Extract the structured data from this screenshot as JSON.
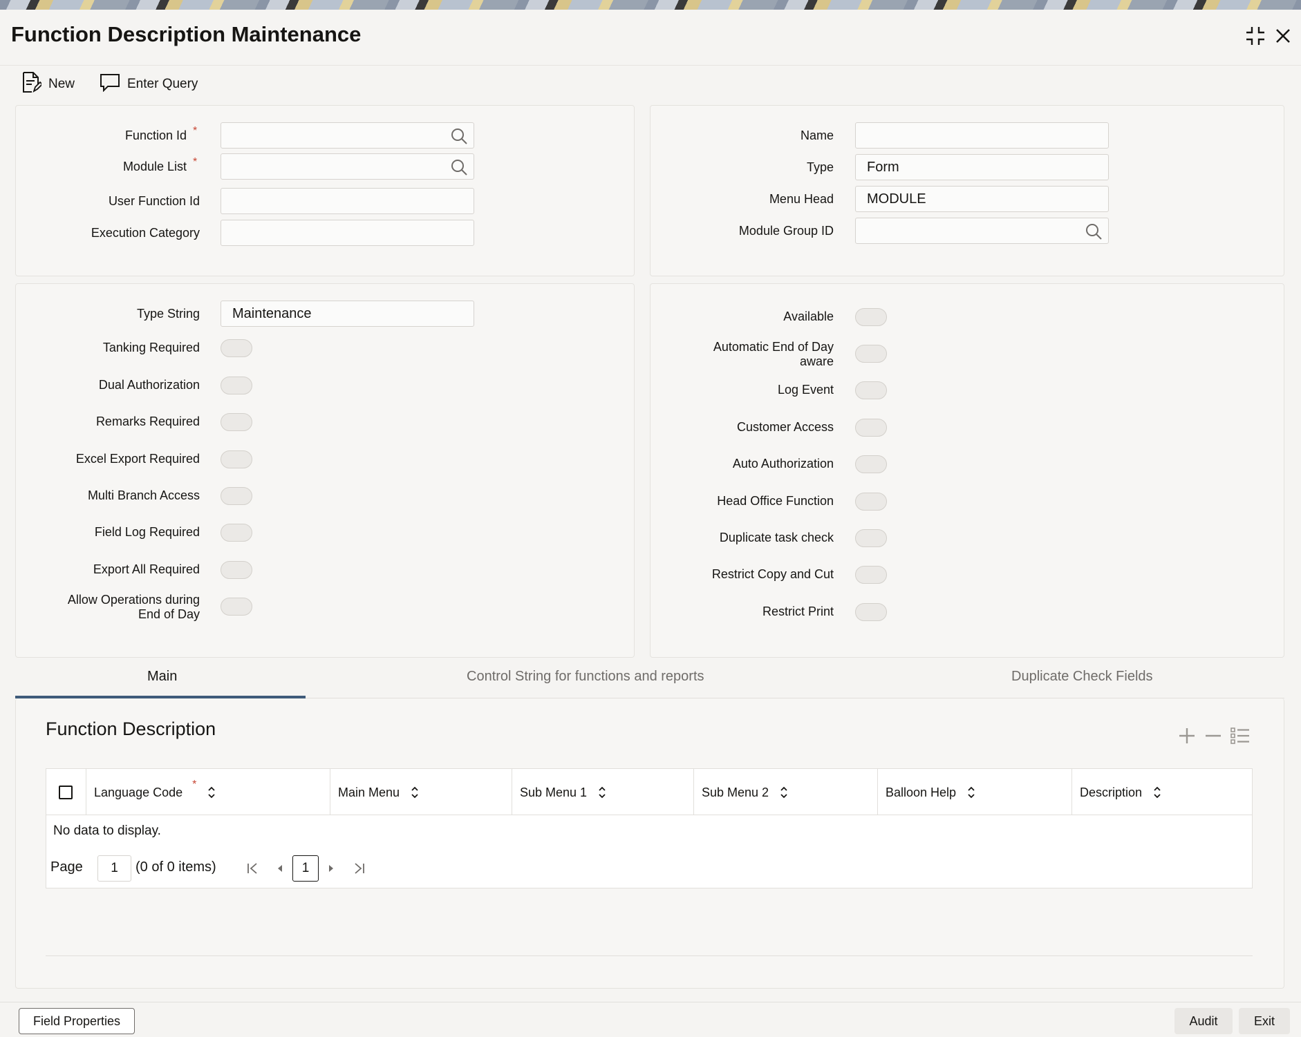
{
  "window": {
    "title": "Function Description Maintenance"
  },
  "toolbar": {
    "new_label": "New",
    "enter_query_label": "Enter Query"
  },
  "header_left": {
    "function_id_label": "Function Id",
    "module_list_label": "Module List",
    "user_function_id_label": "User Function Id",
    "execution_category_label": "Execution Category",
    "required_mark": "*",
    "function_id_value": "",
    "module_list_value": "",
    "user_function_id_value": "",
    "execution_category_value": ""
  },
  "header_right": {
    "name_label": "Name",
    "type_label": "Type",
    "menu_head_label": "Menu Head",
    "module_group_id_label": "Module Group ID",
    "name_value": "",
    "type_value": "Form",
    "menu_head_value": "MODULE",
    "module_group_id_value": ""
  },
  "options_left": {
    "type_string_label": "Type String",
    "type_string_value": "Maintenance",
    "toggles": [
      {
        "label": "Tanking Required",
        "on": false
      },
      {
        "label": "Dual Authorization",
        "on": false
      },
      {
        "label": "Remarks Required",
        "on": false
      },
      {
        "label": "Excel Export Required",
        "on": false
      },
      {
        "label": "Multi Branch Access",
        "on": false
      },
      {
        "label": "Field Log Required",
        "on": false
      },
      {
        "label": "Export All Required",
        "on": false
      },
      {
        "label_line1": "Allow Operations during",
        "label_line2": "End of Day",
        "on": false
      }
    ]
  },
  "options_right": {
    "toggles": [
      {
        "label": "Available",
        "on": false
      },
      {
        "label_line1": "Automatic End of Day",
        "label_line2": "aware",
        "on": false
      },
      {
        "label": "Log Event",
        "on": false
      },
      {
        "label": "Customer Access",
        "on": false
      },
      {
        "label": "Auto Authorization",
        "on": false
      },
      {
        "label": "Head Office Function",
        "on": false
      },
      {
        "label": "Duplicate task check",
        "on": false
      },
      {
        "label": "Restrict Copy and Cut",
        "on": false
      },
      {
        "label": "Restrict Print",
        "on": false
      }
    ]
  },
  "tabs": [
    {
      "label": "Main",
      "active": true
    },
    {
      "label": "Control String for functions and reports",
      "active": false
    },
    {
      "label": "Duplicate Check Fields",
      "active": false
    }
  ],
  "grid": {
    "title": "Function Description",
    "columns": [
      "Language Code",
      "Main Menu",
      "Sub Menu 1",
      "Sub Menu 2",
      "Balloon Help",
      "Description"
    ],
    "required_mark": "*",
    "empty_text": "No data to display.",
    "page_label": "Page",
    "page_value": "1",
    "items_text": "(0 of 0 items)",
    "current_page": "1"
  },
  "footer": {
    "field_properties_label": "Field Properties",
    "audit_label": "Audit",
    "exit_label": "Exit"
  },
  "colors": {
    "required": "#c74634",
    "tab_active_underline": "#3f5b7a",
    "panel_bg": "#f7f6f4"
  }
}
